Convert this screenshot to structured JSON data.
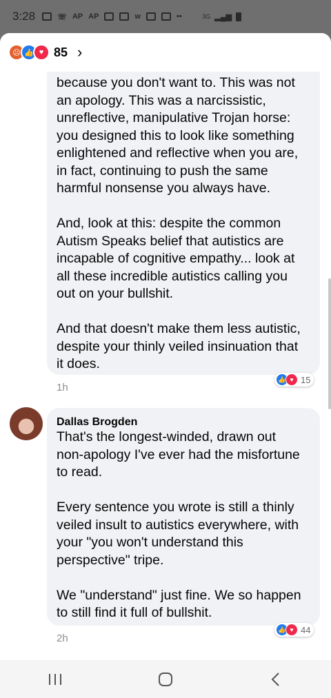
{
  "status_bar": {
    "time": "3:28",
    "icons": [
      "AP",
      "AP",
      "w"
    ],
    "network": "3G"
  },
  "reactions_header": {
    "icons": [
      "angry-icon",
      "like-icon",
      "love-icon"
    ],
    "count": "85"
  },
  "comments": [
    {
      "paragraphs": [
        "because you don't want to. This was not\nan apology. This was a narcissistic,\nunreflective, manipulative Trojan horse:\nyou designed this to look like something\nenlightened and reflective when you are,\nin fact, continuing to push the same\nharmful nonsense you always have.",
        "And, look at this: despite the common\nAutism Speaks belief that autistics are\nincapable of cognitive empathy... look at\nall these incredible autistics calling you\nout on your bullshit.",
        "And that doesn't make them less autistic,\ndespite your thinly veiled insinuation that\nit does."
      ],
      "time": "1h",
      "reaction_count": "15"
    },
    {
      "author": "Dallas Brogden",
      "paragraphs": [
        "That's the longest-winded, drawn out\nnon-apology I've ever had the misfortune\nto read.",
        "Every sentence you wrote is still a thinly\nveiled insult to autistics everywhere, with\nyour \"you won't understand this\nperspective\" tripe.",
        "We \"understand\" just fine. We so happen\nto still find it full of bullshit."
      ],
      "time": "2h",
      "reaction_count": "44"
    }
  ],
  "colors": {
    "bubble": "#f0f2f5",
    "like": "#1f7bf2",
    "love": "#f0284a",
    "angry": "#e4602c"
  }
}
